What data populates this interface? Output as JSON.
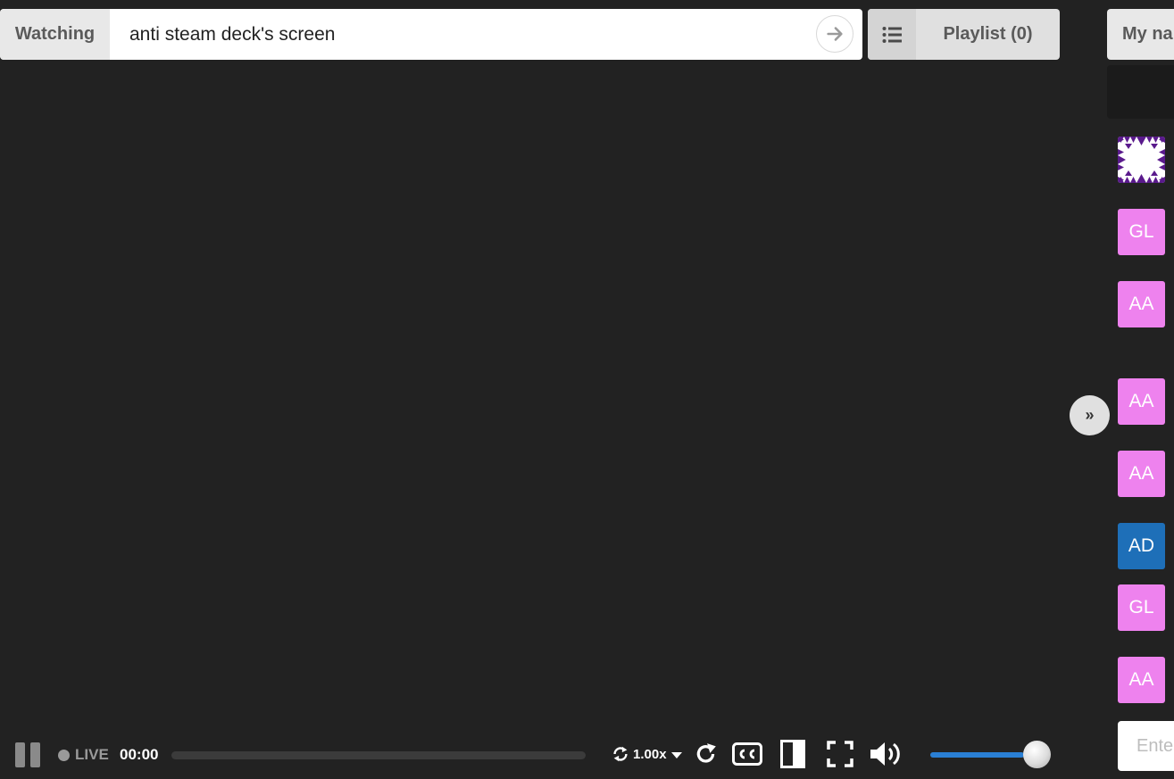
{
  "header": {
    "watching_label": "Watching",
    "video_input_value": "anti steam deck's screen",
    "playlist_label": "Playlist (0)",
    "name_label": "My na"
  },
  "sidebar": {
    "collapse_label": "»",
    "avatars": [
      {
        "initials": "GL",
        "color": "#ee82ee"
      },
      {
        "initials": "AA",
        "color": "#ee82ee"
      },
      {
        "initials": "AA",
        "color": "#ee82ee"
      },
      {
        "initials": "AA",
        "color": "#ee82ee"
      },
      {
        "initials": "AD",
        "color": "#1e6fb8"
      },
      {
        "initials": "GL",
        "color": "#ee82ee"
      },
      {
        "initials": "AA",
        "color": "#ee82ee"
      }
    ],
    "chat_placeholder": "Enter"
  },
  "controls": {
    "live_label": "LIVE",
    "time": "00:00",
    "speed": "1.00x",
    "volume_fraction": 0.85
  }
}
